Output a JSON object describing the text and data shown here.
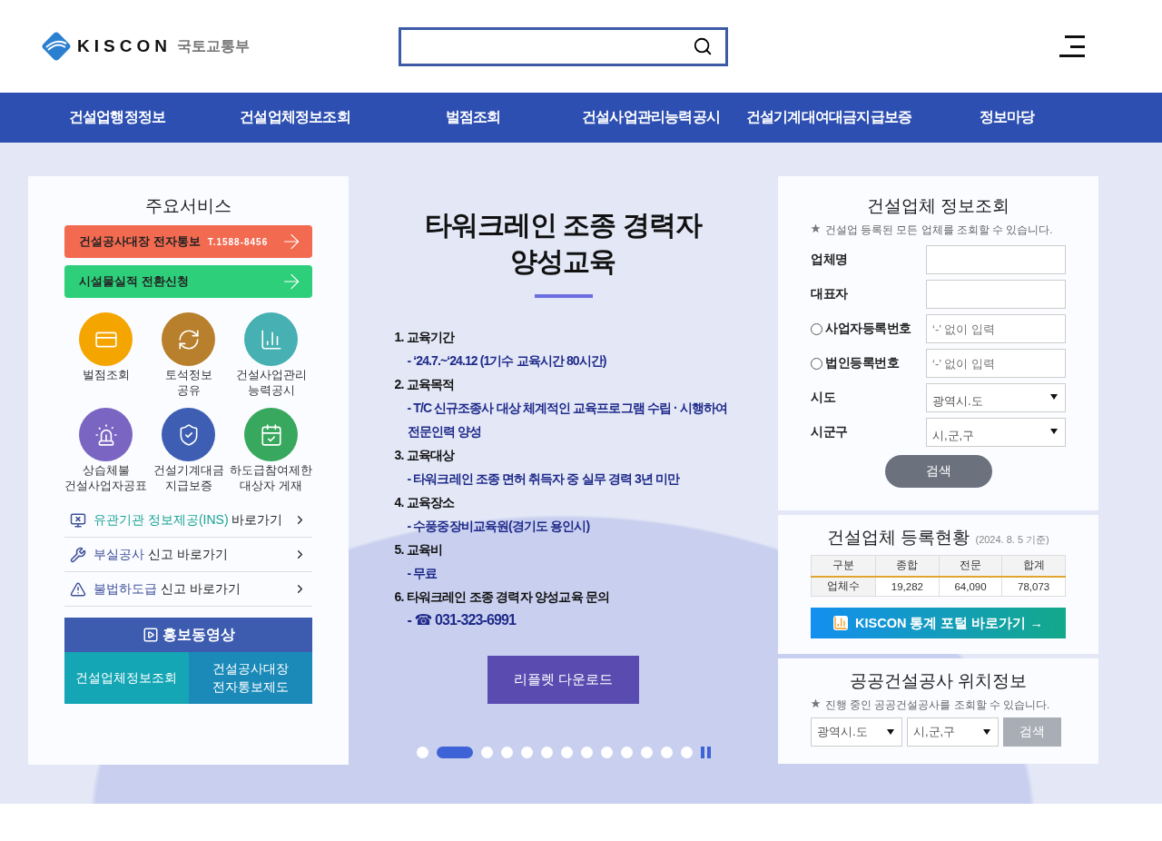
{
  "header": {
    "logo": {
      "brand": "KISCON",
      "ministry": "국토교통부"
    }
  },
  "nav": [
    "건설업행정정보",
    "건설업체정보조회",
    "벌점조회",
    "건설사업관리능력공시",
    "건설기계대여대금지급보증",
    "정보마당"
  ],
  "services": {
    "title": "주요서비스",
    "banners": [
      {
        "text": "건설공사대장 전자통보",
        "phone": "T.1588-8456",
        "color": "#f26a50"
      },
      {
        "text": "시설물실적 전환신청",
        "color": "#2ecf7a"
      }
    ],
    "tiles": [
      {
        "kind": "card",
        "lines": [
          "벌점조회"
        ],
        "color": "#f5a500"
      },
      {
        "kind": "refresh",
        "lines": [
          "토석정보",
          "공유"
        ],
        "color": "#b8802c"
      },
      {
        "kind": "chart",
        "lines": [
          "건설사업관리",
          "능력공시"
        ],
        "color": "#46b0b2"
      },
      {
        "kind": "siren",
        "lines": [
          "상습체불",
          "건설사업자공표"
        ],
        "color": "#7a66c2"
      },
      {
        "kind": "shield",
        "lines": [
          "건설기계대금",
          "지급보증"
        ],
        "color": "#3e5eb4"
      },
      {
        "kind": "calendar",
        "lines": [
          "하도급참여제한",
          "대상자 게재"
        ],
        "color": "#38a85e"
      }
    ],
    "links": [
      {
        "kind": "monitor",
        "highlight": "유관기관 정보제공(INS)",
        "rest": "바로가기",
        "color": "#1aa394"
      },
      {
        "kind": "tools",
        "highlight": "부실공사",
        "rest": "신고 바로가기",
        "color": "#3d4f9a"
      },
      {
        "kind": "warning",
        "highlight": "불법하도급",
        "rest": "신고 바로가기",
        "color": "#3d4f9a"
      }
    ],
    "video": {
      "title": "홍보동영상",
      "buttons": [
        {
          "lines": [
            "건설업체정보조회"
          ]
        },
        {
          "lines": [
            "건설공사대장",
            "전자통보제도"
          ]
        }
      ]
    }
  },
  "slide": {
    "title": [
      "타워크레인 조종 경력자",
      "양성교육"
    ],
    "items": [
      {
        "heading": "1. 교육기간",
        "detail": "- ‘24.7.~‘24.12 (1기수 교육시간 80시간)"
      },
      {
        "heading": "2.  교육목적",
        "detail": "- T/C 신규조종사 대상 체계적인 교육프로그램 수립 · 시행하여 전문인력 양성"
      },
      {
        "heading": "3. 교육대상",
        "detail": "- 타워크레인 조종 면허 취득자 중 실무 경력 3년 미만"
      },
      {
        "heading": "4. 교육장소",
        "detail": "-  수풍중장비교육원(경기도 용인시)"
      },
      {
        "heading": "5. 교육비",
        "detail": "- 무료"
      },
      {
        "heading": "6. 타워크레인 조종 경력자 양성교육 문의",
        "detail": "- ☎ 031-323-6991",
        "large": true
      }
    ],
    "button": "리플렛 다운로드",
    "dots": [
      {
        "selected": false
      },
      {
        "selected": true
      },
      {
        "selected": false
      },
      {
        "selected": false
      },
      {
        "selected": false
      },
      {
        "selected": false
      },
      {
        "selected": false
      },
      {
        "selected": false
      },
      {
        "selected": false
      },
      {
        "selected": false
      },
      {
        "selected": false
      },
      {
        "selected": false
      },
      {
        "selected": false
      }
    ]
  },
  "company_search": {
    "title": "건설업체 정보조회",
    "note": "건설업 등록된 모든 업체를 조회할 수 있습니다.",
    "fields": [
      {
        "kind": "text",
        "label": "업체명"
      },
      {
        "kind": "text",
        "label": "대표자"
      },
      {
        "kind": "radio",
        "label": "사업자등록번호",
        "placeholder": "‘-’ 없이 입력",
        "selected": false
      },
      {
        "kind": "radio",
        "label": "법인등록번호",
        "placeholder": "‘-’ 없이 입력",
        "selected": false
      },
      {
        "kind": "select",
        "label": "시도",
        "value": "광역시.도"
      },
      {
        "kind": "select",
        "label": "시군구",
        "value": "시,군,구"
      }
    ],
    "button": "검색"
  },
  "registration": {
    "title": "건설업체 등록현황",
    "date": "(2024. 8. 5 기준)",
    "columns": [
      "구분",
      "종합",
      "전문",
      "합계"
    ],
    "row": [
      "업체수",
      "19,282",
      "64,090",
      "78,073"
    ],
    "portal_button": "KISCON 통계 포털 바로가기 →"
  },
  "location": {
    "title": "공공건설공사 위치정보",
    "note": "진행 중인 공공건설공사를 조회할 수 있습니다.",
    "selects": [
      "광역시.도",
      "시,군,구"
    ],
    "button": "검색"
  }
}
